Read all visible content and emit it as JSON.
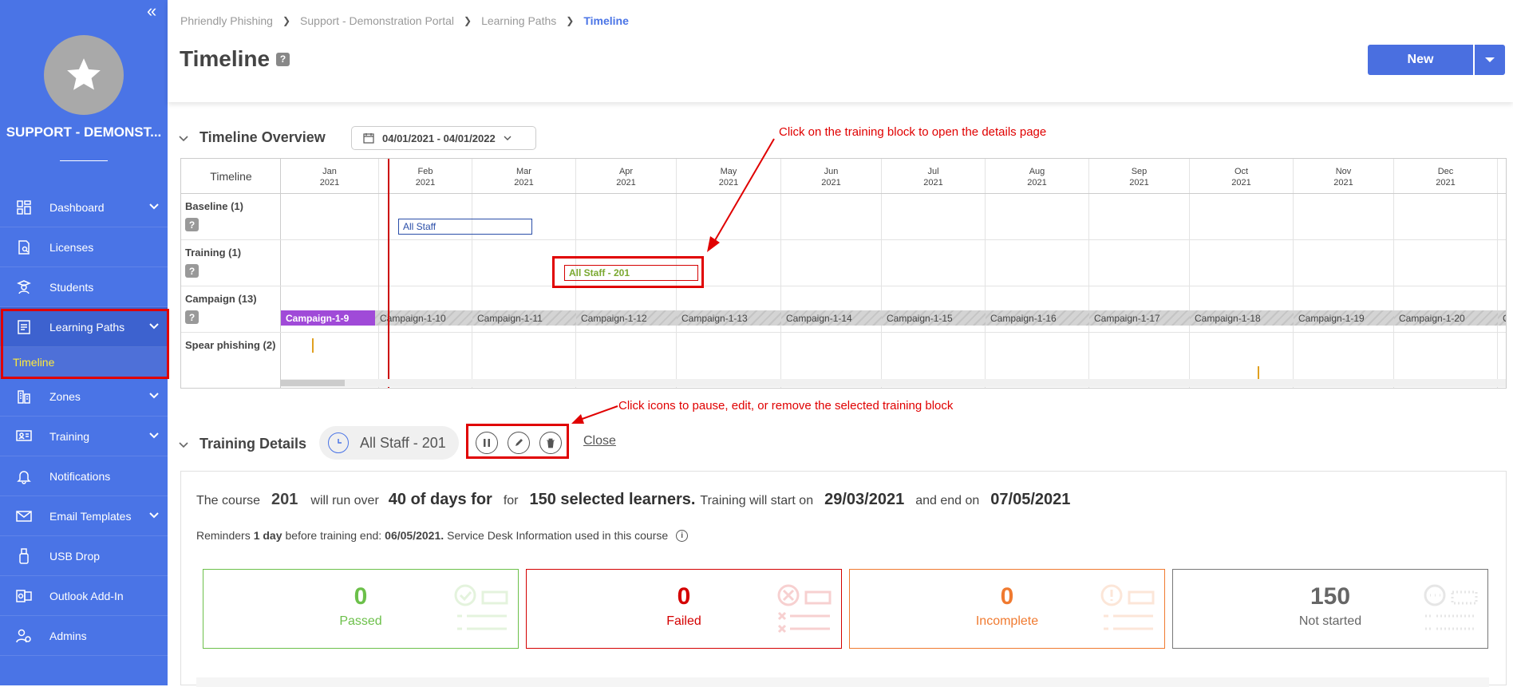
{
  "sidebar": {
    "org_name": "SUPPORT - DEMONST...",
    "items": [
      {
        "label": "Dashboard",
        "icon": "dashboard-icon",
        "has_children": true
      },
      {
        "label": "Licenses",
        "icon": "license-icon",
        "has_children": false
      },
      {
        "label": "Students",
        "icon": "student-icon",
        "has_children": false
      },
      {
        "label": "Learning Paths",
        "icon": "learning-paths-icon",
        "has_children": true,
        "active": true
      },
      {
        "label": "Zones",
        "icon": "zones-icon",
        "has_children": true
      },
      {
        "label": "Training",
        "icon": "training-icon",
        "has_children": true
      },
      {
        "label": "Notifications",
        "icon": "bell-icon",
        "has_children": false
      },
      {
        "label": "Email Templates",
        "icon": "envelope-icon",
        "has_children": true
      },
      {
        "label": "USB Drop",
        "icon": "usb-icon",
        "has_children": false
      },
      {
        "label": "Outlook Add-In",
        "icon": "outlook-icon",
        "has_children": false
      },
      {
        "label": "Admins",
        "icon": "admins-icon",
        "has_children": false
      }
    ],
    "subitem": "Timeline"
  },
  "breadcrumb": [
    "Phriendly Phishing",
    "Support - Demonstration Portal",
    "Learning Paths",
    "Timeline"
  ],
  "page_title": "Timeline",
  "help_glyph": "?",
  "new_button": "New",
  "overview": {
    "title": "Timeline Overview",
    "date_range": "04/01/2021 - 04/01/2022",
    "header_label": "Timeline",
    "months": [
      {
        "m": "Jan",
        "y": "2021"
      },
      {
        "m": "Feb",
        "y": "2021"
      },
      {
        "m": "Mar",
        "y": "2021"
      },
      {
        "m": "Apr",
        "y": "2021"
      },
      {
        "m": "May",
        "y": "2021"
      },
      {
        "m": "Jun",
        "y": "2021"
      },
      {
        "m": "Jul",
        "y": "2021"
      },
      {
        "m": "Aug",
        "y": "2021"
      },
      {
        "m": "Sep",
        "y": "2021"
      },
      {
        "m": "Oct",
        "y": "2021"
      },
      {
        "m": "Nov",
        "y": "2021"
      },
      {
        "m": "Dec",
        "y": "2021"
      }
    ],
    "rows": {
      "baseline": "Baseline (1)",
      "training": "Training (1)",
      "campaign": "Campaign (13)",
      "spear": "Spear phishing (2)"
    },
    "baseline_block": "All Staff",
    "training_block": "All Staff - 201",
    "campaigns": [
      "Campaign-1-9",
      "Campaign-1-10",
      "Campaign-1-11",
      "Campaign-1-12",
      "Campaign-1-13",
      "Campaign-1-14",
      "Campaign-1-15",
      "Campaign-1-16",
      "Campaign-1-17",
      "Campaign-1-18",
      "Campaign-1-19",
      "Campaign-1-20",
      "C"
    ]
  },
  "annotations": {
    "a1": "Click on the training block to open the details page",
    "a2": "Click icons to pause, edit, or remove the selected training block"
  },
  "training_details": {
    "title": "Training Details",
    "selected": "All Staff - 201",
    "close": "Close",
    "sentence": {
      "t1": "The course",
      "course": "201",
      "t2": "will run over",
      "days": "40 of days for",
      "t3": "for",
      "learners": "150 selected learners.",
      "t4": "Training will start on",
      "start": "29/03/2021",
      "t5": "and end on",
      "end": "07/05/2021"
    },
    "reminder": {
      "t1": "Reminders",
      "days": "1 day",
      "t2": "before training end:",
      "date": "06/05/2021.",
      "t3": "Service Desk Information used in this course"
    },
    "stats": [
      {
        "value": "0",
        "label": "Passed",
        "color": "#6cc04a"
      },
      {
        "value": "0",
        "label": "Failed",
        "color": "#d40000"
      },
      {
        "value": "0",
        "label": "Incomplete",
        "color": "#f07a30"
      },
      {
        "value": "150",
        "label": "Not started",
        "color": "#666666"
      }
    ]
  }
}
